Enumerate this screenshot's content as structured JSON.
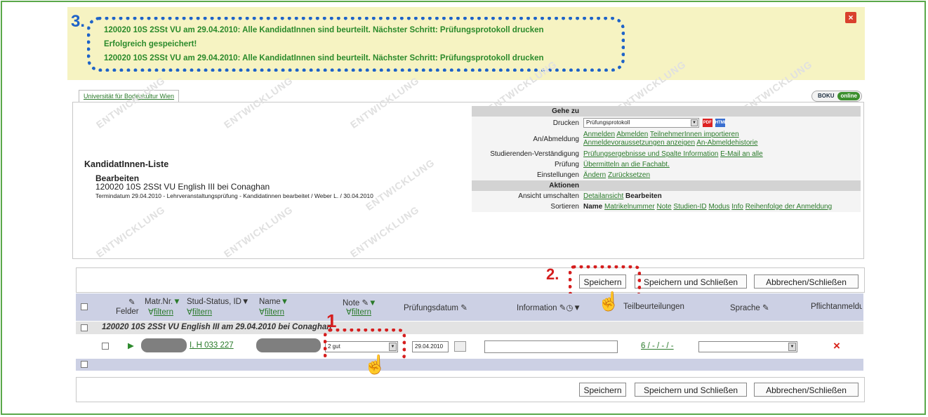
{
  "annotations": {
    "step1": "1",
    "step2": "2.",
    "step3": "3."
  },
  "messages": [
    "120020 10S 2SSt VU am 29.04.2010: Alle KandidatInnen sind beurteilt. Nächster Schritt: Prüfungsprotokoll drucken",
    "Erfolgreich gespeichert!",
    "120020 10S 2SSt VU am 29.04.2010: Alle KandidatInnen sind beurteilt. Nächster Schritt: Prüfungsprotokoll drucken"
  ],
  "close_symbol": "×",
  "header": {
    "uni_tab": "Universität für Bodenkultur Wien",
    "logo": {
      "left": "BOKU",
      "right": "online"
    },
    "title": "KandidatInnen-Liste",
    "mode": "Bearbeiten",
    "course": "120020 10S 2SSt VU English III bei Conaghan",
    "meta": "Termindatum 29.04.2010 - Lehrveranstaltungsprüfung - Kandidatinnen bearbeitet / Weber L. / 30.04.2010",
    "watermark": "ENTWICKLUNG"
  },
  "goto": {
    "heading": "Gehe zu",
    "drucken_label": "Drucken",
    "drucken_value": "Prüfungsprotokoll",
    "pdf": "PDF",
    "htm": "HTML",
    "anab_label": "An/Abmeldung",
    "anab_links": [
      "Anmelden",
      "Abmelden",
      "TeilnehmerInnen importieren",
      "Anmeldevoraussetzungen anzeigen",
      "An-Abmeldehistorie"
    ],
    "stud_label": "Studierenden-Verständigung",
    "stud_links": [
      "Prüfungsergebnisse und Spalte Information",
      "E-Mail an alle"
    ],
    "pruef_label": "Prüfung",
    "pruef_link": "Übermitteln an die Fachabt.",
    "einst_label": "Einstellungen",
    "einst_links": [
      "Ändern",
      "Zurücksetzen"
    ],
    "aktionen": "Aktionen",
    "ansicht_label": "Ansicht umschalten",
    "ansicht_link": "Detailansicht",
    "ansicht_current": "Bearbeiten",
    "sort_label": "Sortieren",
    "sort_current": "Name",
    "sort_links": [
      "Matrikelnummer",
      "Note",
      "Studien-ID",
      "Modus",
      "Info",
      "Reihenfolge der Anmeldung"
    ]
  },
  "buttons": {
    "save": "Speichern",
    "save_close": "Speichern und Schließen",
    "cancel_close": "Abbrechen/Schließen"
  },
  "table": {
    "felder": "Felder",
    "matr": "Matr.Nr.",
    "stud": "Stud-Status, ID",
    "name": "Name",
    "note": "Note",
    "filter": "filtern",
    "datum": "Prüfungsdatum",
    "info": "Information",
    "teil": "Teilbeurteilungen",
    "sprache": "Sprache",
    "pflicht": "Pflichtanmeldung",
    "group": "120020 10S 2SSt VU English III am 29.04.2010 bei Conaghan",
    "row": {
      "id_text": "I, H 033 227",
      "note_value": "2 gut",
      "date_value": "29.04.2010",
      "info_value": "",
      "teil_value": "6 / - / - / -",
      "sprache_value": "",
      "delete": "×"
    }
  }
}
